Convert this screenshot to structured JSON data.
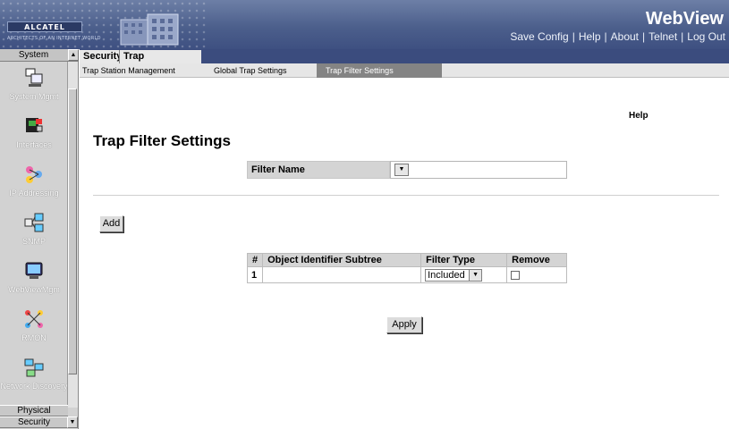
{
  "header": {
    "logo_text": "ALCATEL",
    "logo_tagline": "ARCHITECTS OF AN INTERNET WORLD",
    "app_title": "WebView",
    "links": [
      "Save Config",
      "Help",
      "About",
      "Telnet",
      "Log Out"
    ],
    "separator": "|"
  },
  "sidebar": {
    "header": "System",
    "items": [
      {
        "label": "System Mgmt",
        "icon": "system-mgmt-icon"
      },
      {
        "label": "Interfaces",
        "icon": "interfaces-icon"
      },
      {
        "label": "IP Addressing",
        "icon": "ip-addressing-icon"
      },
      {
        "label": "SNMP",
        "icon": "snmp-icon"
      },
      {
        "label": "WebViewMgm",
        "icon": "webview-mgmt-icon"
      },
      {
        "label": "RMON",
        "icon": "rmon-icon"
      },
      {
        "label": "Network Discovery",
        "icon": "network-discovery-icon"
      }
    ],
    "bottom_items": [
      "Physical",
      "Security"
    ]
  },
  "tabs": {
    "main": [
      "Security",
      "Trap Management"
    ],
    "sub": [
      "Trap Station Management",
      "Global Trap Settings",
      "Trap Filter Settings"
    ],
    "active_sub": "Trap Filter Settings"
  },
  "main": {
    "help_label": "Help",
    "page_title": "Trap Filter Settings",
    "filter_name_label": "Filter Name",
    "filter_name_value": "",
    "add_label": "Add",
    "apply_label": "Apply",
    "table": {
      "headers": [
        "#",
        "Object Identifier Subtree",
        "Filter Type",
        "Remove"
      ],
      "rows": [
        {
          "num": "1",
          "oid": "",
          "filter_type": "Included",
          "remove": false
        }
      ]
    }
  },
  "colors": {
    "header_blue": "#4c5f8c",
    "tab_bar": "#3b4c7e",
    "active_subtab": "#848484",
    "sidebar_bg": "#d2d2d2"
  }
}
